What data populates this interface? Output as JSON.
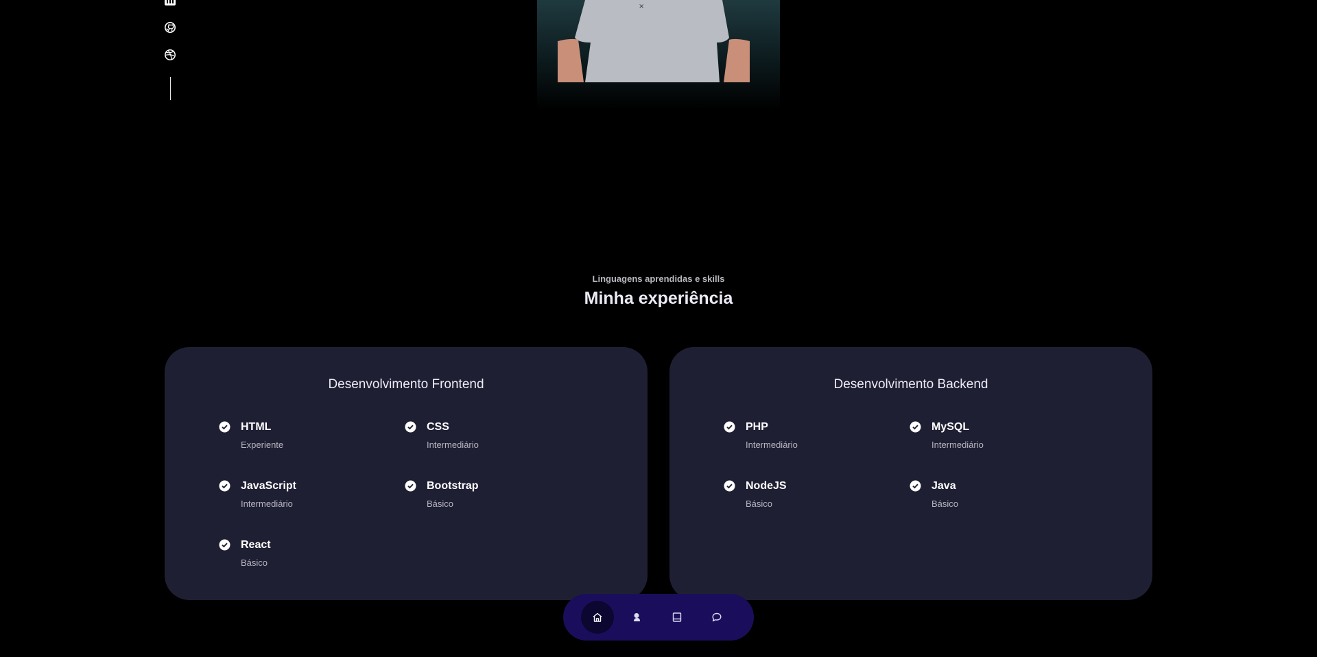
{
  "social": [
    {
      "icon": "linkedin-icon"
    },
    {
      "icon": "github-icon"
    },
    {
      "icon": "dribbble-icon"
    }
  ],
  "experience": {
    "subtitle": "Linguagens aprendidas e skills",
    "title": "Minha experiência",
    "frontend": {
      "title": "Desenvolvimento Frontend",
      "skills": [
        {
          "name": "HTML",
          "level": "Experiente"
        },
        {
          "name": "CSS",
          "level": "Intermediário"
        },
        {
          "name": "JavaScript",
          "level": "Intermediário"
        },
        {
          "name": "Bootstrap",
          "level": "Básico"
        },
        {
          "name": "React",
          "level": "Básico"
        }
      ]
    },
    "backend": {
      "title": "Desenvolvimento Backend",
      "skills": [
        {
          "name": "PHP",
          "level": "Intermediário"
        },
        {
          "name": "MySQL",
          "level": "Intermediário"
        },
        {
          "name": "NodeJS",
          "level": "Básico"
        },
        {
          "name": "Java",
          "level": "Básico"
        }
      ]
    }
  },
  "bottom_nav": [
    {
      "icon": "home-icon",
      "active": true
    },
    {
      "icon": "user-icon",
      "active": false
    },
    {
      "icon": "book-icon",
      "active": false
    },
    {
      "icon": "chat-icon",
      "active": false
    }
  ],
  "colors": {
    "background": "#000000",
    "card": "#1f1f33",
    "nav": "#1a0e5c",
    "nav_active": "#0b0730"
  }
}
